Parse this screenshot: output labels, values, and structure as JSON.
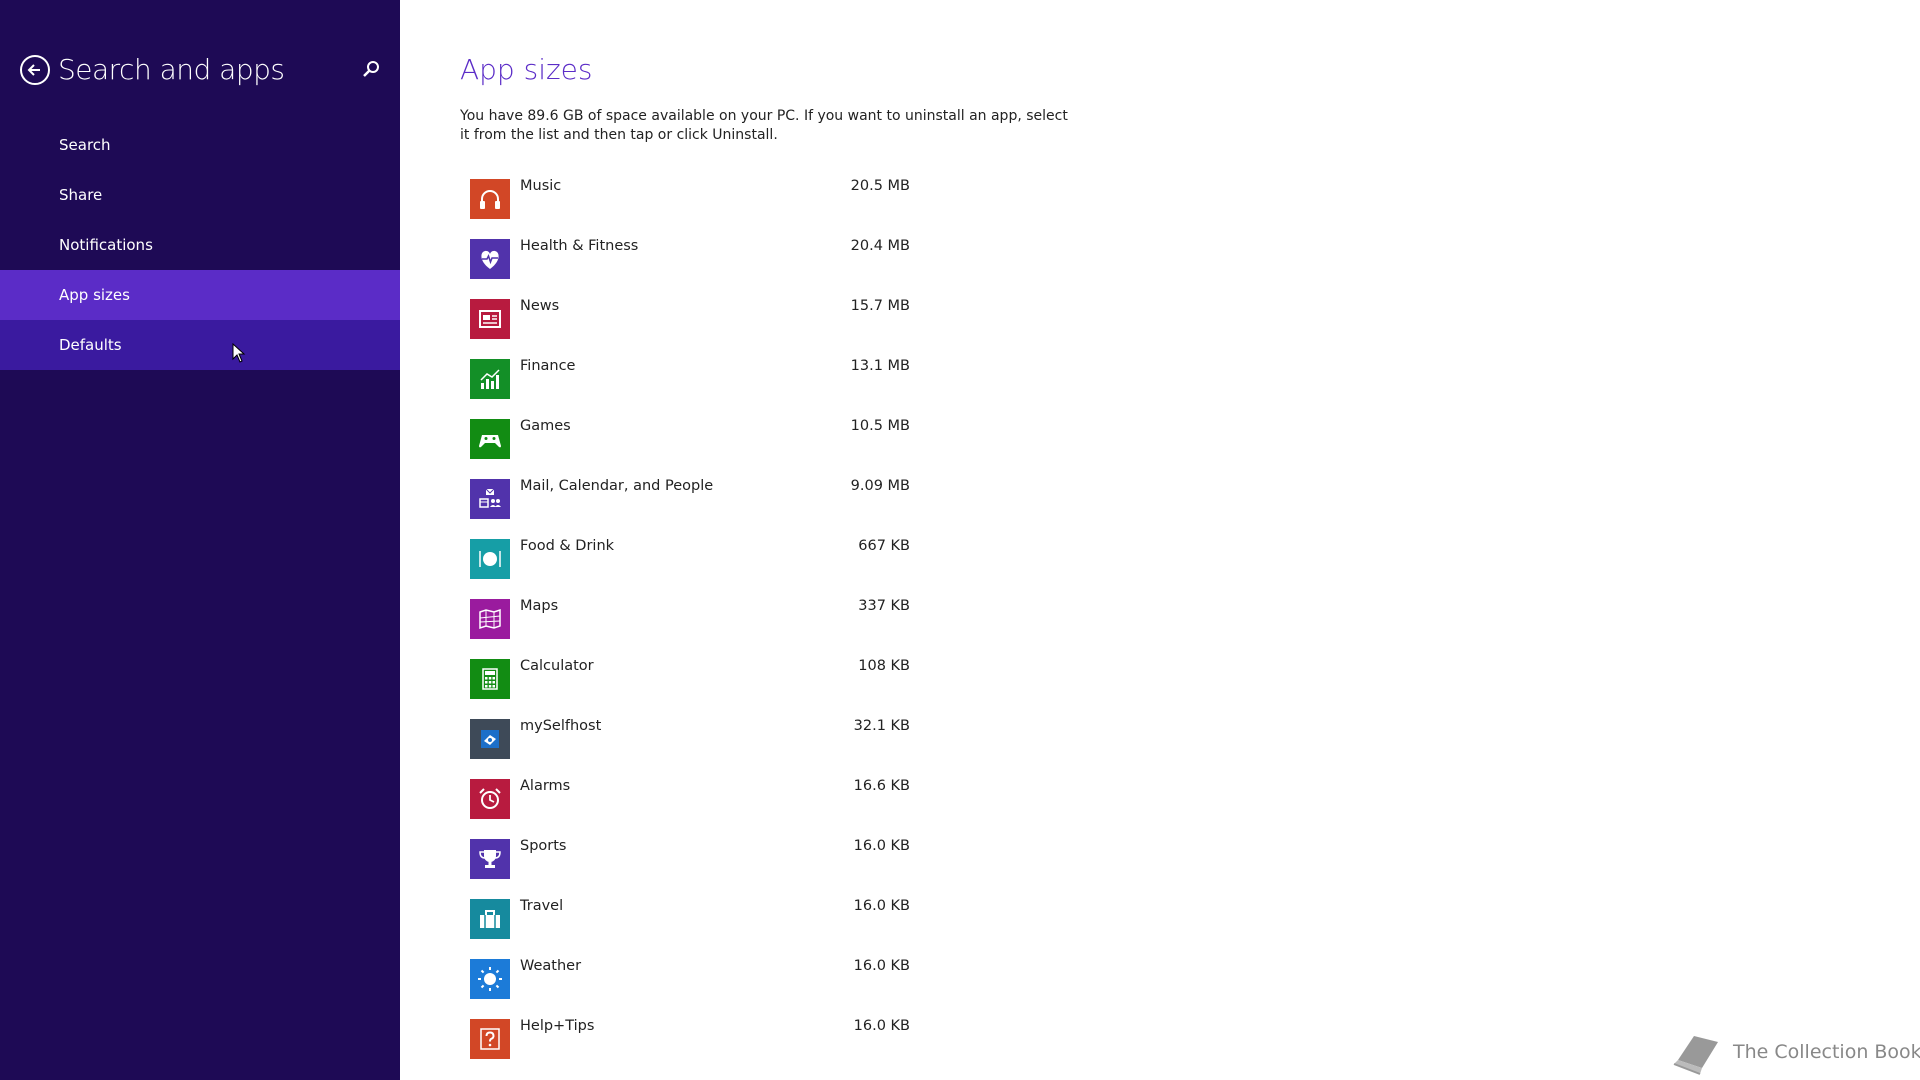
{
  "sidebar": {
    "title": "Search and apps",
    "items": [
      {
        "label": "Search",
        "state": "normal"
      },
      {
        "label": "Share",
        "state": "normal"
      },
      {
        "label": "Notifications",
        "state": "normal"
      },
      {
        "label": "App sizes",
        "state": "active"
      },
      {
        "label": "Defaults",
        "state": "hover"
      }
    ]
  },
  "main": {
    "title": "App sizes",
    "description": "You have 89.6 GB of space available on your PC. If you want to uninstall an app, select it from the list and then tap or click Uninstall.",
    "apps": [
      {
        "name": "Music",
        "size": "20.5 MB",
        "icon": "headphones-icon",
        "color": "#d24726"
      },
      {
        "name": "Health & Fitness",
        "size": "20.4 MB",
        "icon": "heart-pulse-icon",
        "color": "#5133ab"
      },
      {
        "name": "News",
        "size": "15.7 MB",
        "icon": "newspaper-icon",
        "color": "#b81b3f"
      },
      {
        "name": "Finance",
        "size": "13.1 MB",
        "icon": "chart-icon",
        "color": "#138f27"
      },
      {
        "name": "Games",
        "size": "10.5 MB",
        "icon": "gamepad-icon",
        "color": "#128c13"
      },
      {
        "name": "Mail, Calendar, and People",
        "size": "9.09 MB",
        "icon": "mail-people-icon",
        "color": "#5133ab"
      },
      {
        "name": "Food & Drink",
        "size": "667 KB",
        "icon": "plate-icon",
        "color": "#169ea6"
      },
      {
        "name": "Maps",
        "size": "337 KB",
        "icon": "map-icon",
        "color": "#9a1b9e"
      },
      {
        "name": "Calculator",
        "size": "108 KB",
        "icon": "calculator-icon",
        "color": "#128c13"
      },
      {
        "name": "mySelfhost",
        "size": "32.1 KB",
        "icon": "selfhost-icon",
        "color": "#3e4a58"
      },
      {
        "name": "Alarms",
        "size": "16.6 KB",
        "icon": "alarm-clock-icon",
        "color": "#b81b3f"
      },
      {
        "name": "Sports",
        "size": "16.0 KB",
        "icon": "trophy-icon",
        "color": "#5133ab"
      },
      {
        "name": "Travel",
        "size": "16.0 KB",
        "icon": "suitcase-icon",
        "color": "#168a9e"
      },
      {
        "name": "Weather",
        "size": "16.0 KB",
        "icon": "sun-icon",
        "color": "#1c7bd8"
      },
      {
        "name": "Help+Tips",
        "size": "16.0 KB",
        "icon": "help-icon",
        "color": "#d24726"
      }
    ]
  },
  "watermark": {
    "text": "The Collection Book",
    "icon": "book-icon"
  }
}
